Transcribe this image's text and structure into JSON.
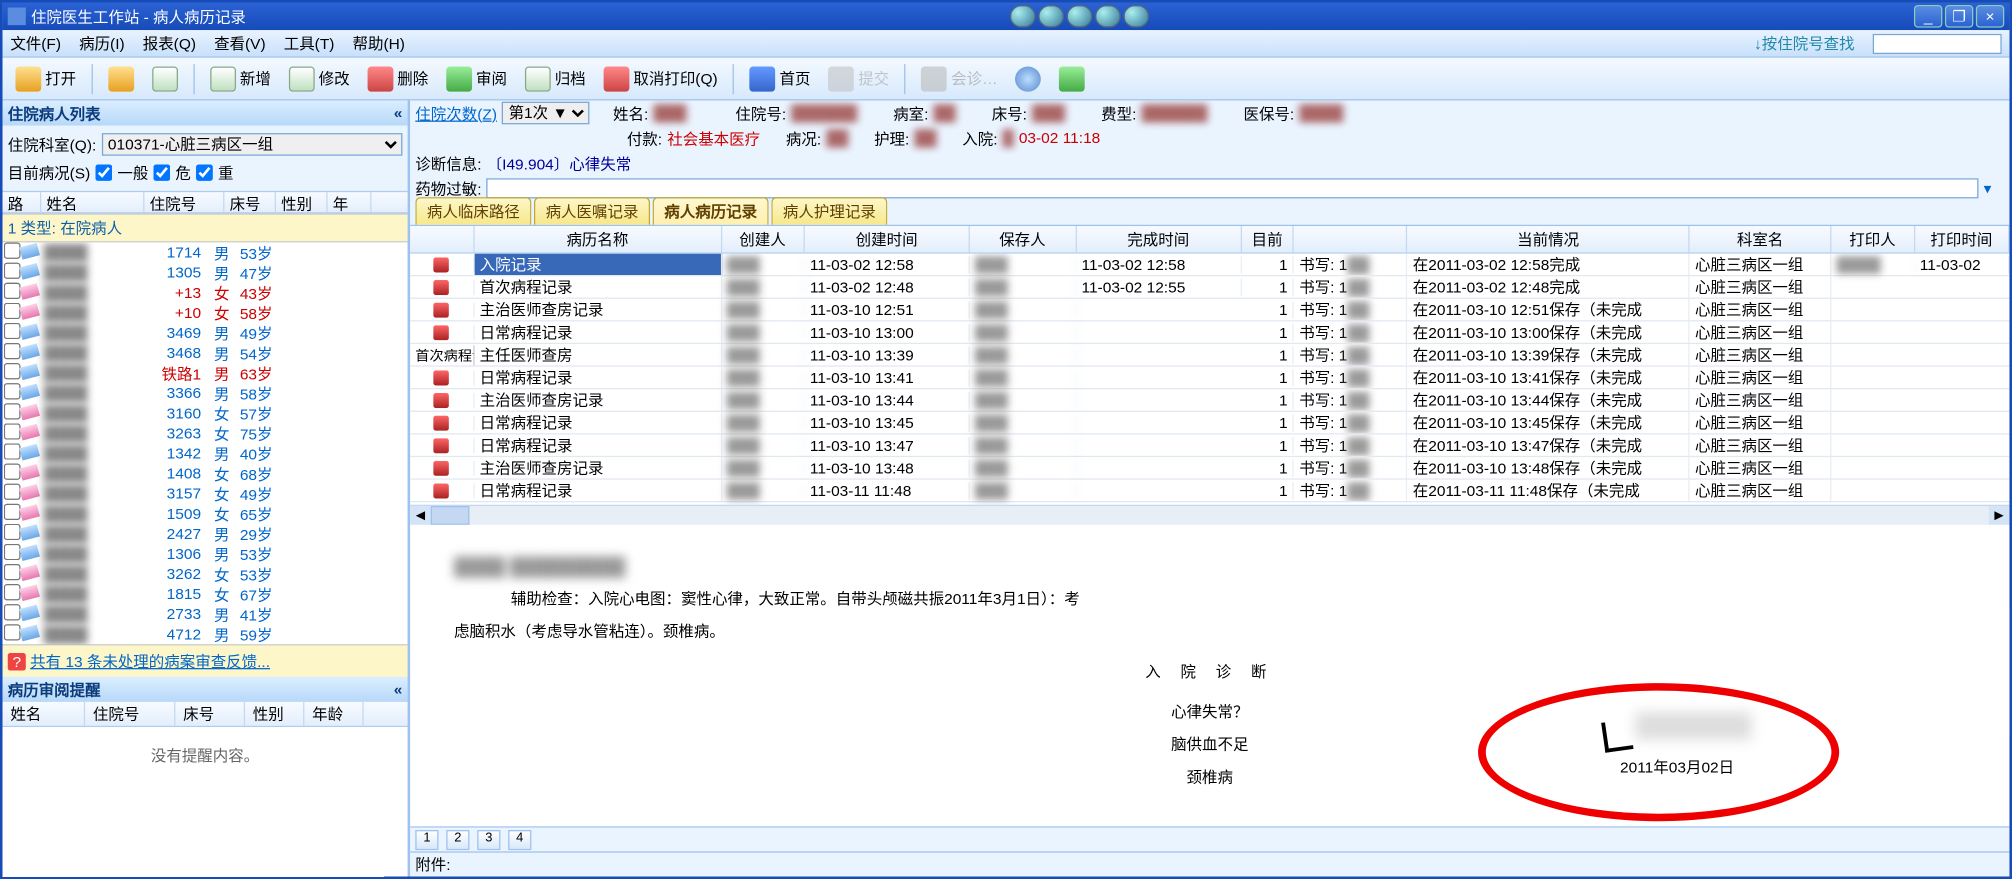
{
  "window": {
    "title": "住院医生工作站 - 病人病历记录",
    "minimize": "_",
    "maximize": "❐",
    "close": "×"
  },
  "menu": [
    "文件(F)",
    "病历(I)",
    "报表(Q)",
    "查看(V)",
    "工具(T)",
    "帮助(H)"
  ],
  "menu_right": {
    "label": "↓按住院号查找",
    "value": ""
  },
  "toolbar": {
    "open": "打开",
    "new": "新增",
    "edit": "修改",
    "delete": "删除",
    "review": "审阅",
    "archive": "归档",
    "cancel_print": "取消打印(Q)",
    "home": "首页",
    "submit": "提交",
    "consult": "会诊…"
  },
  "left": {
    "panel_title": "住院病人列表",
    "ward_label": "住院科室(Q):",
    "ward_value": "010371-心脏三病区一组",
    "cond_label": "目前病况(S)",
    "chk_general": "一般",
    "chk_danger": "危",
    "chk_heavy": "重",
    "cols": {
      "bed": "路",
      "name": "姓名",
      "hosp_no": "住院号",
      "bed2": "床号",
      "sex": "性别",
      "age": "年"
    },
    "category": "1 类型: 在院病人",
    "patients": [
      {
        "num": "1714",
        "sex": "男",
        "age": "53岁",
        "cls": "blue",
        "pink": false
      },
      {
        "num": "1305",
        "sex": "男",
        "age": "47岁",
        "cls": "blue",
        "pink": false
      },
      {
        "num": "+13",
        "sex": "女",
        "age": "43岁",
        "cls": "red",
        "pink": true
      },
      {
        "num": "+10",
        "sex": "女",
        "age": "58岁",
        "cls": "red",
        "pink": true
      },
      {
        "num": "3469",
        "sex": "男",
        "age": "49岁",
        "cls": "blue",
        "pink": false
      },
      {
        "num": "3468",
        "sex": "男",
        "age": "54岁",
        "cls": "blue",
        "pink": false
      },
      {
        "num": "铁路1",
        "sex": "男",
        "age": "63岁",
        "cls": "red",
        "pink": false
      },
      {
        "num": "3366",
        "sex": "男",
        "age": "58岁",
        "cls": "blue",
        "pink": false
      },
      {
        "num": "3160",
        "sex": "女",
        "age": "57岁",
        "cls": "blue",
        "pink": true
      },
      {
        "num": "3263",
        "sex": "女",
        "age": "75岁",
        "cls": "blue",
        "pink": true
      },
      {
        "num": "1342",
        "sex": "男",
        "age": "40岁",
        "cls": "blue",
        "pink": false
      },
      {
        "num": "1408",
        "sex": "女",
        "age": "68岁",
        "cls": "blue",
        "pink": true
      },
      {
        "num": "3157",
        "sex": "女",
        "age": "49岁",
        "cls": "blue",
        "pink": true
      },
      {
        "num": "1509",
        "sex": "女",
        "age": "65岁",
        "cls": "blue",
        "pink": true
      },
      {
        "num": "2427",
        "sex": "男",
        "age": "29岁",
        "cls": "blue",
        "pink": false
      },
      {
        "num": "1306",
        "sex": "男",
        "age": "53岁",
        "cls": "blue",
        "pink": false
      },
      {
        "num": "3262",
        "sex": "女",
        "age": "53岁",
        "cls": "blue",
        "pink": true
      },
      {
        "num": "1815",
        "sex": "女",
        "age": "67岁",
        "cls": "blue",
        "pink": true
      },
      {
        "num": "2733",
        "sex": "男",
        "age": "41岁",
        "cls": "blue",
        "pink": false
      },
      {
        "num": "4712",
        "sex": "男",
        "age": "59岁",
        "cls": "blue",
        "pink": false
      }
    ],
    "link": "共有 13 条未处理的病案审查反馈...",
    "reminder_title": "病历审阅提醒",
    "rem_cols": [
      "姓名",
      "住院号",
      "床号",
      "性别",
      "年龄"
    ],
    "rem_empty": "没有提醒内容。"
  },
  "info": {
    "visit_label": "住院次数(Z)",
    "visit_value": "第1次 ▼",
    "name_label": "姓名:",
    "hosp_label": "住院号:",
    "room_label": "病室:",
    "bed_label": "床号:",
    "fee_label": "费型:",
    "ins_label": "医保号:",
    "pay_label": "付款:",
    "pay_value": "社会基本医疗",
    "cond_label2": "病况:",
    "nurse_label": "护理:",
    "admit_label": "入院:",
    "admit_value": "03-02 11:18",
    "diag_label": "诊断信息:",
    "diag_value": "〔I49.904〕心律失常",
    "drug_label": "药物过敏:"
  },
  "tabs": [
    "病人临床路径",
    "病人医嘱记录",
    "病人病历记录",
    "病人护理记录"
  ],
  "active_tab": 2,
  "rec_cols": {
    "name": "病历名称",
    "creator": "创建人",
    "ctime": "创建时间",
    "saver": "保存人",
    "ftime": "完成时间",
    "step": "目前",
    "status": "",
    "curinfo": "当前情况",
    "dept": "科室名",
    "printer": "打印人",
    "ptime": "打印时间"
  },
  "records": [
    {
      "group": "",
      "name": "入院记录",
      "ctime": "11-03-02 12:58",
      "ftime": "11-03-02 12:58",
      "step": "1",
      "status": "书写: 1",
      "curinfo": "在2011-03-02 12:58完成",
      "dept": "心脏三病区一组",
      "ptime": "11-03-02",
      "sel": true
    },
    {
      "group": "",
      "name": "首次病程记录",
      "ctime": "11-03-02 12:48",
      "ftime": "11-03-02 12:55",
      "step": "1",
      "status": "书写: 1",
      "curinfo": "在2011-03-02 12:48完成",
      "dept": "心脏三病区一组",
      "ptime": ""
    },
    {
      "group": "",
      "name": "主治医师查房记录",
      "ctime": "11-03-10 12:51",
      "ftime": "",
      "step": "1",
      "status": "书写: 1",
      "curinfo": "在2011-03-10 12:51保存（未完成",
      "dept": "心脏三病区一组",
      "ptime": ""
    },
    {
      "group": "",
      "name": "日常病程记录",
      "ctime": "11-03-10 13:00",
      "ftime": "",
      "step": "1",
      "status": "书写: 1",
      "curinfo": "在2011-03-10 13:00保存（未完成",
      "dept": "心脏三病区一组",
      "ptime": ""
    },
    {
      "group": "首次病程记录",
      "name": "主任医师查房",
      "ctime": "11-03-10 13:39",
      "ftime": "",
      "step": "1",
      "status": "书写: 1",
      "curinfo": "在2011-03-10 13:39保存（未完成",
      "dept": "心脏三病区一组",
      "ptime": ""
    },
    {
      "group": "",
      "name": "日常病程记录",
      "ctime": "11-03-10 13:41",
      "ftime": "",
      "step": "1",
      "status": "书写: 1",
      "curinfo": "在2011-03-10 13:41保存（未完成",
      "dept": "心脏三病区一组",
      "ptime": ""
    },
    {
      "group": "",
      "name": "主治医师查房记录",
      "ctime": "11-03-10 13:44",
      "ftime": "",
      "step": "1",
      "status": "书写: 1",
      "curinfo": "在2011-03-10 13:44保存（未完成",
      "dept": "心脏三病区一组",
      "ptime": ""
    },
    {
      "group": "",
      "name": "日常病程记录",
      "ctime": "11-03-10 13:45",
      "ftime": "",
      "step": "1",
      "status": "书写: 1",
      "curinfo": "在2011-03-10 13:45保存（未完成",
      "dept": "心脏三病区一组",
      "ptime": ""
    },
    {
      "group": "",
      "name": "日常病程记录",
      "ctime": "11-03-10 13:47",
      "ftime": "",
      "step": "1",
      "status": "书写: 1",
      "curinfo": "在2011-03-10 13:47保存（未完成",
      "dept": "心脏三病区一组",
      "ptime": ""
    },
    {
      "group": "",
      "name": "主治医师查房记录",
      "ctime": "11-03-10 13:48",
      "ftime": "",
      "step": "1",
      "status": "书写: 1",
      "curinfo": "在2011-03-10 13:48保存（未完成",
      "dept": "心脏三病区一组",
      "ptime": ""
    },
    {
      "group": "",
      "name": "日常病程记录",
      "ctime": "11-03-11 11:48",
      "ftime": "",
      "step": "1",
      "status": "书写: 1",
      "curinfo": "在2011-03-11 11:48保存（未完成",
      "dept": "心脏三病区一组",
      "ptime": ""
    }
  ],
  "doc": {
    "header": "████  █████████",
    "line1": "辅助检查：入院心电图：窦性心律，大致正常。自带头颅磁共振2011年3月1日）：考",
    "line2": "虑脑积水（考虑导水管粘连）。颈椎病。",
    "center_title": "入  院  诊  断",
    "diag1": "心律失常？",
    "diag2": "脑供血不足",
    "diag3": "颈椎病",
    "sig_date": "2011年03月02日",
    "pages": [
      "1",
      "2",
      "3",
      "4"
    ],
    "attach_label": "附件:"
  }
}
